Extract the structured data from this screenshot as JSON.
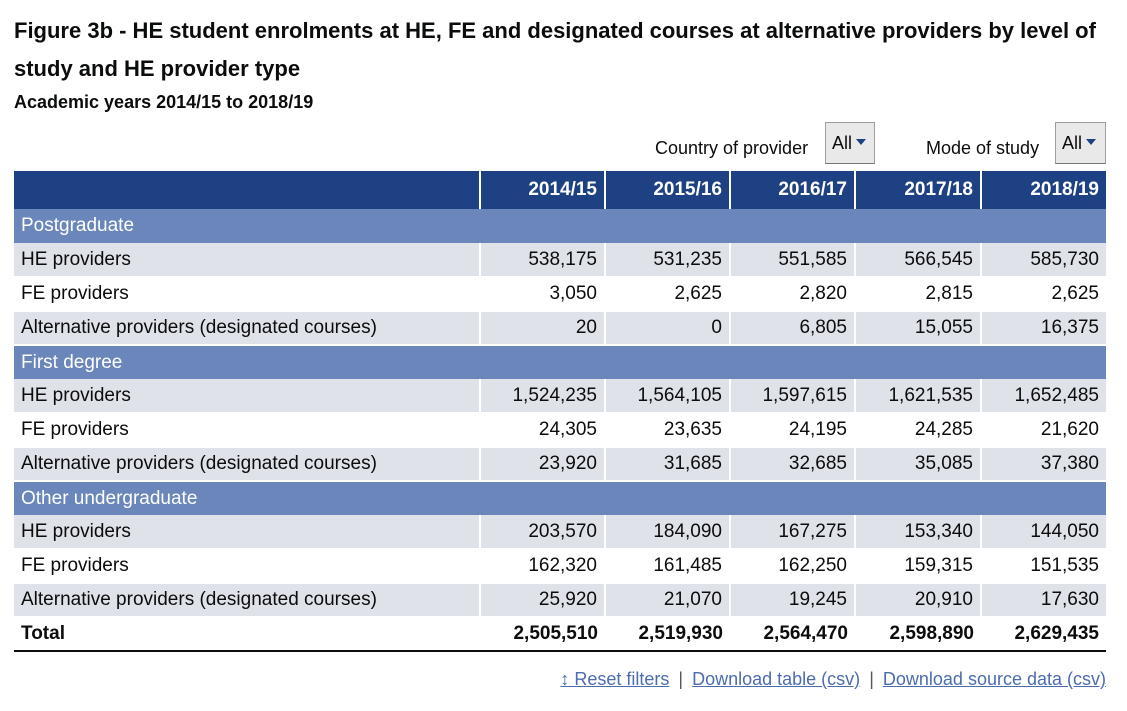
{
  "figure": {
    "title": "Figure 3b -  HE student enrolments at HE, FE and designated courses at alternative providers by level of study and HE provider type",
    "subtitle": "Academic years 2014/15 to 2018/19"
  },
  "filters": {
    "country_label": "Country of provider",
    "country_value": "All",
    "mode_label": "Mode of study",
    "mode_value": "All"
  },
  "chart_data": {
    "type": "table",
    "columns": [
      "2014/15",
      "2015/16",
      "2016/17",
      "2017/18",
      "2018/19"
    ],
    "sections": [
      {
        "name": "Postgraduate",
        "rows": [
          {
            "label": "HE providers",
            "values": [
              "538,175",
              "531,235",
              "551,585",
              "566,545",
              "585,730"
            ]
          },
          {
            "label": "FE providers",
            "values": [
              "3,050",
              "2,625",
              "2,820",
              "2,815",
              "2,625"
            ]
          },
          {
            "label": "Alternative providers (designated courses)",
            "values": [
              "20",
              "0",
              "6,805",
              "15,055",
              "16,375"
            ]
          }
        ]
      },
      {
        "name": "First degree",
        "rows": [
          {
            "label": "HE providers",
            "values": [
              "1,524,235",
              "1,564,105",
              "1,597,615",
              "1,621,535",
              "1,652,485"
            ]
          },
          {
            "label": "FE providers",
            "values": [
              "24,305",
              "23,635",
              "24,195",
              "24,285",
              "21,620"
            ]
          },
          {
            "label": "Alternative providers (designated courses)",
            "values": [
              "23,920",
              "31,685",
              "32,685",
              "35,085",
              "37,380"
            ]
          }
        ]
      },
      {
        "name": "Other undergraduate",
        "rows": [
          {
            "label": "HE providers",
            "values": [
              "203,570",
              "184,090",
              "167,275",
              "153,340",
              "144,050"
            ]
          },
          {
            "label": "FE providers",
            "values": [
              "162,320",
              "161,485",
              "162,250",
              "159,315",
              "151,535"
            ]
          },
          {
            "label": "Alternative providers (designated courses)",
            "values": [
              "25,920",
              "21,070",
              "19,245",
              "20,910",
              "17,630"
            ]
          }
        ]
      }
    ],
    "total": {
      "label": "Total",
      "values": [
        "2,505,510",
        "2,519,930",
        "2,564,470",
        "2,598,890",
        "2,629,435"
      ]
    }
  },
  "links": {
    "reset": "↕ Reset filters",
    "separator": "|",
    "download_table": "Download table (csv)",
    "download_source": "Download source data (csv)"
  },
  "colors": {
    "header_bg": "#1d4183",
    "section_bg": "#6a86ba",
    "row_shade": "#dfe2e9",
    "link": "#4c6cb0"
  }
}
